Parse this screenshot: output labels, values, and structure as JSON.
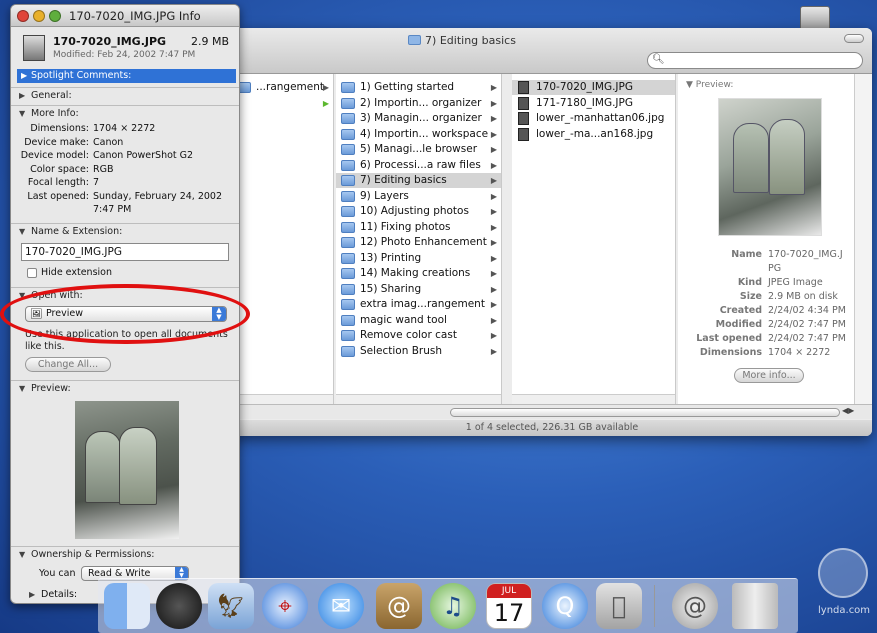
{
  "info": {
    "window_title": "170-7020_IMG.JPG Info",
    "file_name": "170-7020_IMG.JPG",
    "file_size": "2.9 MB",
    "modified": "Modified: Feb 24, 2002 7:47 PM",
    "spotlight_label": "Spotlight Comments:",
    "general_label": "General:",
    "more_info_label": "More Info:",
    "more_info": [
      {
        "key": "Dimensions:",
        "value": "1704 × 2272"
      },
      {
        "key": "Device make:",
        "value": "Canon"
      },
      {
        "key": "Device model:",
        "value": "Canon PowerShot G2"
      },
      {
        "key": "Color space:",
        "value": "RGB"
      },
      {
        "key": "Focal length:",
        "value": "7"
      },
      {
        "key": "Last opened:",
        "value": "Sunday, February 24, 2002"
      },
      {
        "key": "",
        "value": "7:47 PM"
      }
    ],
    "name_ext_label": "Name & Extension:",
    "name_field_value": "170-7020_IMG.JPG",
    "hide_extension_label": "Hide extension",
    "open_with_label": "Open with:",
    "open_with_app": "Preview",
    "use_app_text_1": "Use this application to open all documents",
    "use_app_text_2": "like this.",
    "change_all_label": "Change All...",
    "preview_label": "Preview:",
    "ownership_label": "Ownership & Permissions:",
    "you_can_label": "You can",
    "you_can_value": "Read & Write",
    "details_label": "Details:"
  },
  "finder": {
    "title": "7) Editing basics",
    "col0": [
      {
        "label": "...rangement",
        "arrow": true
      },
      {
        "label": "",
        "arrow": true,
        "green": true
      }
    ],
    "col1": [
      {
        "label": "1) Getting started"
      },
      {
        "label": "2) Importin... organizer"
      },
      {
        "label": "3) Managin... organizer"
      },
      {
        "label": "4) Importin... workspace"
      },
      {
        "label": "5) Managi...le browser"
      },
      {
        "label": "6) Processi...a raw files"
      },
      {
        "label": "7) Editing basics",
        "selected": true
      },
      {
        "label": "9) Layers"
      },
      {
        "label": "10) Adjusting photos"
      },
      {
        "label": "11) Fixing photos"
      },
      {
        "label": "12) Photo Enhancement"
      },
      {
        "label": "13) Printing"
      },
      {
        "label": "14) Making creations"
      },
      {
        "label": "15) Sharing"
      },
      {
        "label": "extra imag...rangement"
      },
      {
        "label": "magic wand tool"
      },
      {
        "label": "Remove color cast"
      },
      {
        "label": "Selection Brush"
      }
    ],
    "col2": [
      {
        "label": "170-7020_IMG.JPG",
        "selected": true
      },
      {
        "label": "171-7180_IMG.JPG"
      },
      {
        "label": "lower_-manhattan06.jpg"
      },
      {
        "label": "lower_-ma...an168.jpg"
      }
    ],
    "preview_label": "Preview:",
    "meta": [
      {
        "key": "Name",
        "value": "170-7020_IMG.J"
      },
      {
        "key": "",
        "value": "PG"
      },
      {
        "key": "Kind",
        "value": "JPEG Image"
      },
      {
        "key": "Size",
        "value": "2.9 MB on disk"
      },
      {
        "key": "Created",
        "value": "2/24/02 4:34 PM"
      },
      {
        "key": "Modified",
        "value": "2/24/02 7:47 PM"
      },
      {
        "key": "Last opened",
        "value": "2/24/02 7:47 PM"
      },
      {
        "key": "Dimensions",
        "value": "1704 × 2272"
      }
    ],
    "more_info_button": "More info...",
    "status": "1 of 4 selected, 226.31 GB available"
  },
  "dock": {
    "calendar_month": "JUL",
    "calendar_day": "17"
  },
  "watermark": "lynda.com"
}
